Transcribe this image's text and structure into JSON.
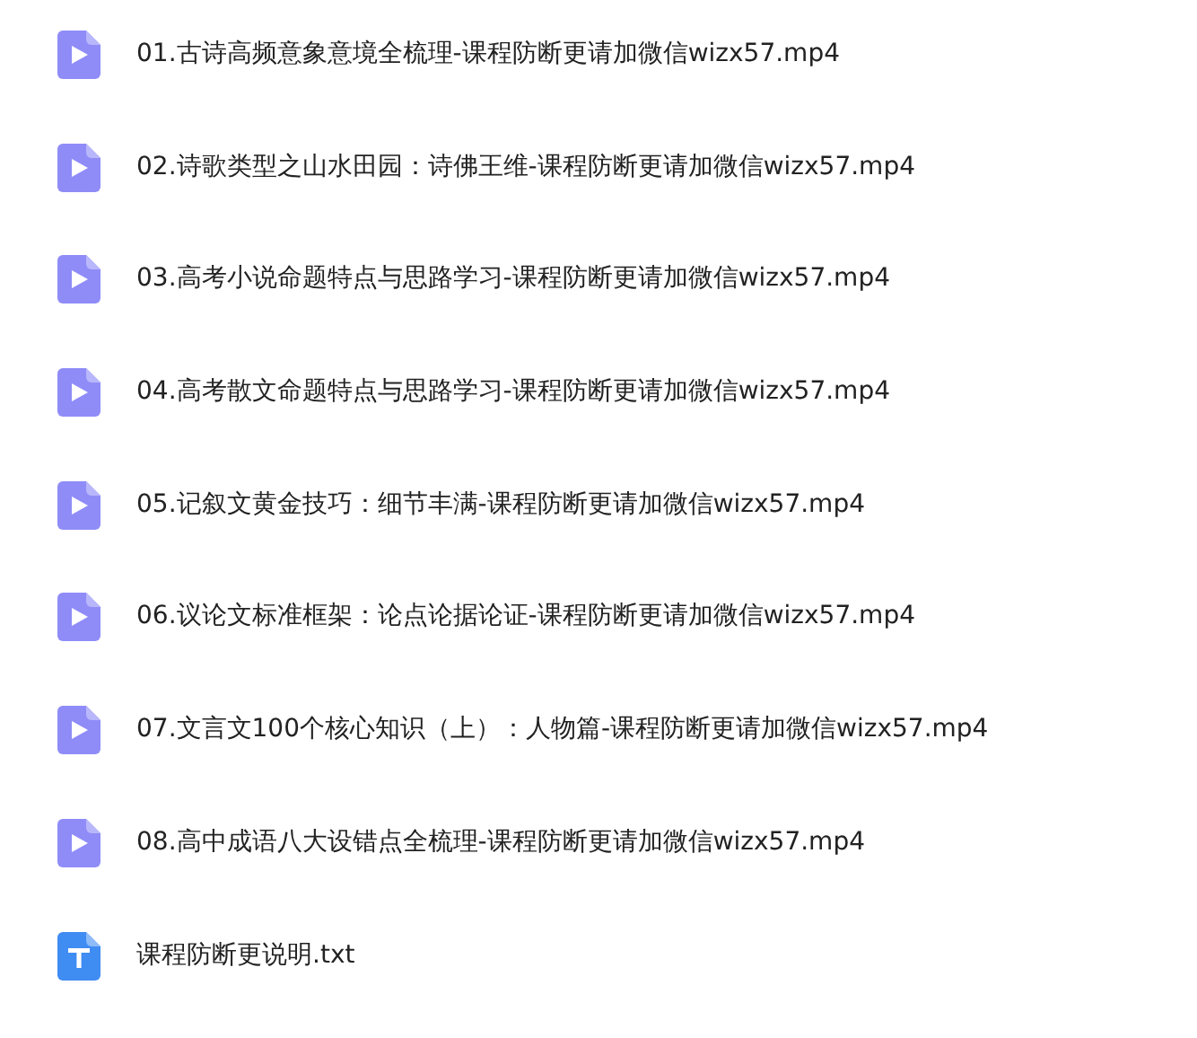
{
  "files": [
    {
      "kind": "video",
      "name": "01.古诗高频意象意境全梳理-课程防断更请加微信wizx57.mp4"
    },
    {
      "kind": "video",
      "name": "02.诗歌类型之山水田园：诗佛王维-课程防断更请加微信wizx57.mp4"
    },
    {
      "kind": "video",
      "name": "03.高考小说命题特点与思路学习-课程防断更请加微信wizx57.mp4"
    },
    {
      "kind": "video",
      "name": "04.高考散文命题特点与思路学习-课程防断更请加微信wizx57.mp4"
    },
    {
      "kind": "video",
      "name": "05.记叙文黄金技巧：细节丰满-课程防断更请加微信wizx57.mp4"
    },
    {
      "kind": "video",
      "name": "06.议论文标准框架：论点论据论证-课程防断更请加微信wizx57.mp4"
    },
    {
      "kind": "video",
      "name": "07.文言文100个核心知识（上）：人物篇-课程防断更请加微信wizx57.mp4"
    },
    {
      "kind": "video",
      "name": "08.高中成语八大设错点全梳理-课程防断更请加微信wizx57.mp4"
    },
    {
      "kind": "text",
      "name": "课程防断更说明.txt"
    }
  ]
}
